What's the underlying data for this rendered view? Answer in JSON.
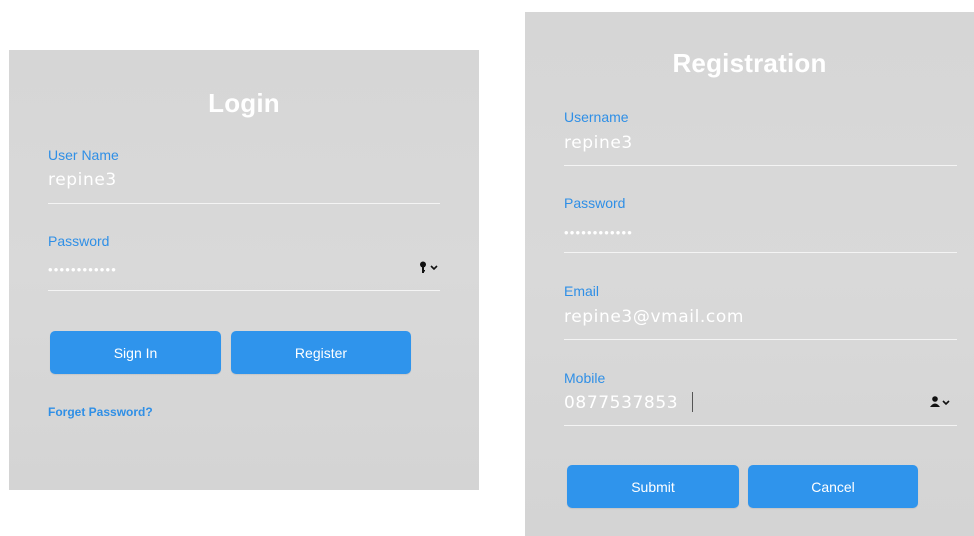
{
  "login": {
    "title": "Login",
    "username_label": "User Name",
    "username_value": "repine3",
    "password_label": "Password",
    "password_value": "••••••••••••",
    "password_icon": "key-icon",
    "signin_label": "Sign In",
    "register_label": "Register",
    "forgot_label": "Forget Password?"
  },
  "registration": {
    "title": "Registration",
    "username_label": "Username",
    "username_value": "repine3",
    "password_label": "Password",
    "password_value": "••••••••••••",
    "email_label": "Email",
    "email_value": "repine3@vmail.com",
    "mobile_label": "Mobile",
    "mobile_value": "0877537853",
    "mobile_icon": "contact-icon",
    "submit_label": "Submit",
    "cancel_label": "Cancel"
  },
  "colors": {
    "accent": "#2f94ec",
    "label": "#2f8fe6",
    "panel": "#d6d6d6",
    "text": "#ffffff"
  }
}
